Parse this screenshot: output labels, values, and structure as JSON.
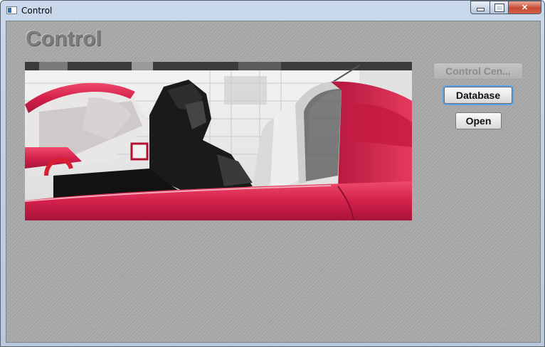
{
  "window": {
    "title": "Control",
    "controls": {
      "minimize": "minimize",
      "maximize": "maximize",
      "close": "✕"
    }
  },
  "main": {
    "heading": "Control",
    "media": {
      "description_icon": "video-frame"
    }
  },
  "actions": {
    "control_center": "Control Cen...",
    "database": "Database",
    "open": "Open"
  },
  "colors": {
    "accent_focus": "#5aa3e6",
    "car_red": "#d4214b",
    "background_gray": "#a6a6a6"
  }
}
